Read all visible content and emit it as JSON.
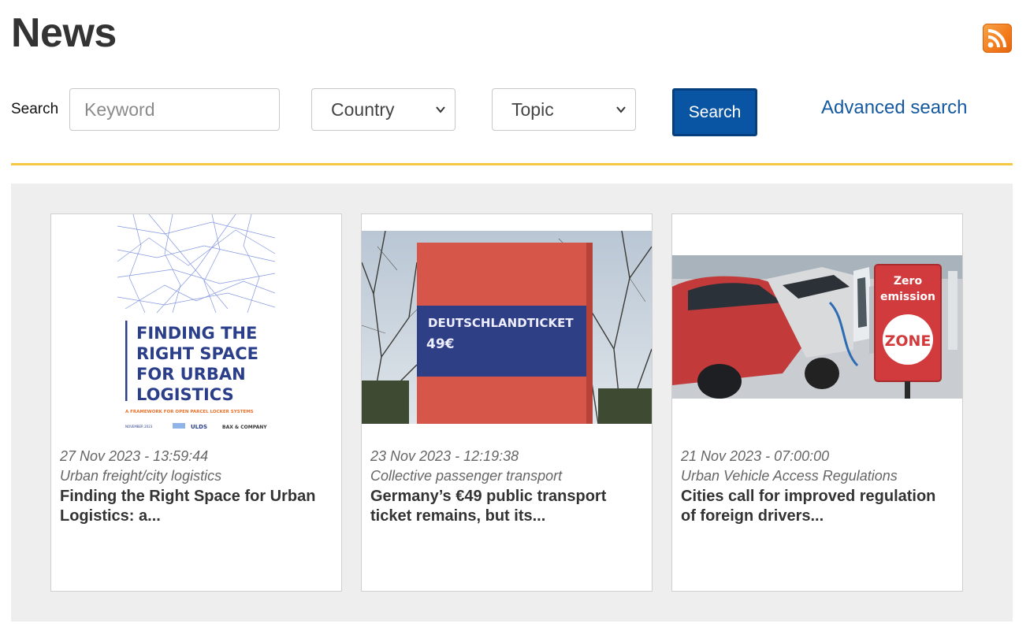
{
  "header": {
    "title": "News"
  },
  "search": {
    "label": "Search",
    "keyword_placeholder": "Keyword",
    "country_selected": "Country",
    "topic_selected": "Topic",
    "button_label": "Search",
    "advanced_link": "Advanced search"
  },
  "colors": {
    "accent_yellow": "#f5c842",
    "button_blue": "#0a55a3",
    "link_blue": "#155aa0",
    "rss_orange": "#f27b1c"
  },
  "icons": [
    "rss-icon",
    "chevron-down-icon"
  ],
  "news": [
    {
      "date": "27 Nov 2023 - 13:59:44",
      "topic": "Urban freight/city logistics",
      "title": "Finding the Right Space for Urban Logistics: a...",
      "image": {
        "heading_lines": [
          "FINDING THE",
          "RIGHT SPACE",
          "FOR URBAN",
          "LOGISTICS"
        ],
        "subtitle": "A FRAMEWORK FOR OPEN PARCEL LOCKER SYSTEMS",
        "footer": [
          "NOVEMBER 2023",
          "ULDS",
          "BAX & COMPANY"
        ]
      }
    },
    {
      "date": "23 Nov 2023 - 12:19:38",
      "topic": "Collective passenger transport",
      "title": "Germany’s €49 public transport ticket remains, but its...",
      "image": {
        "sign_line1": "DEUTSCHLANDTICKET",
        "sign_line2": "49€"
      }
    },
    {
      "date": "21 Nov 2023 - 07:00:00",
      "topic": "Urban Vehicle Access Regulations",
      "title": "Cities call for improved regulation of foreign drivers...",
      "image": {
        "sign_line1": "Zero",
        "sign_line2": "emission",
        "sign_zone": "ZONE"
      }
    }
  ]
}
